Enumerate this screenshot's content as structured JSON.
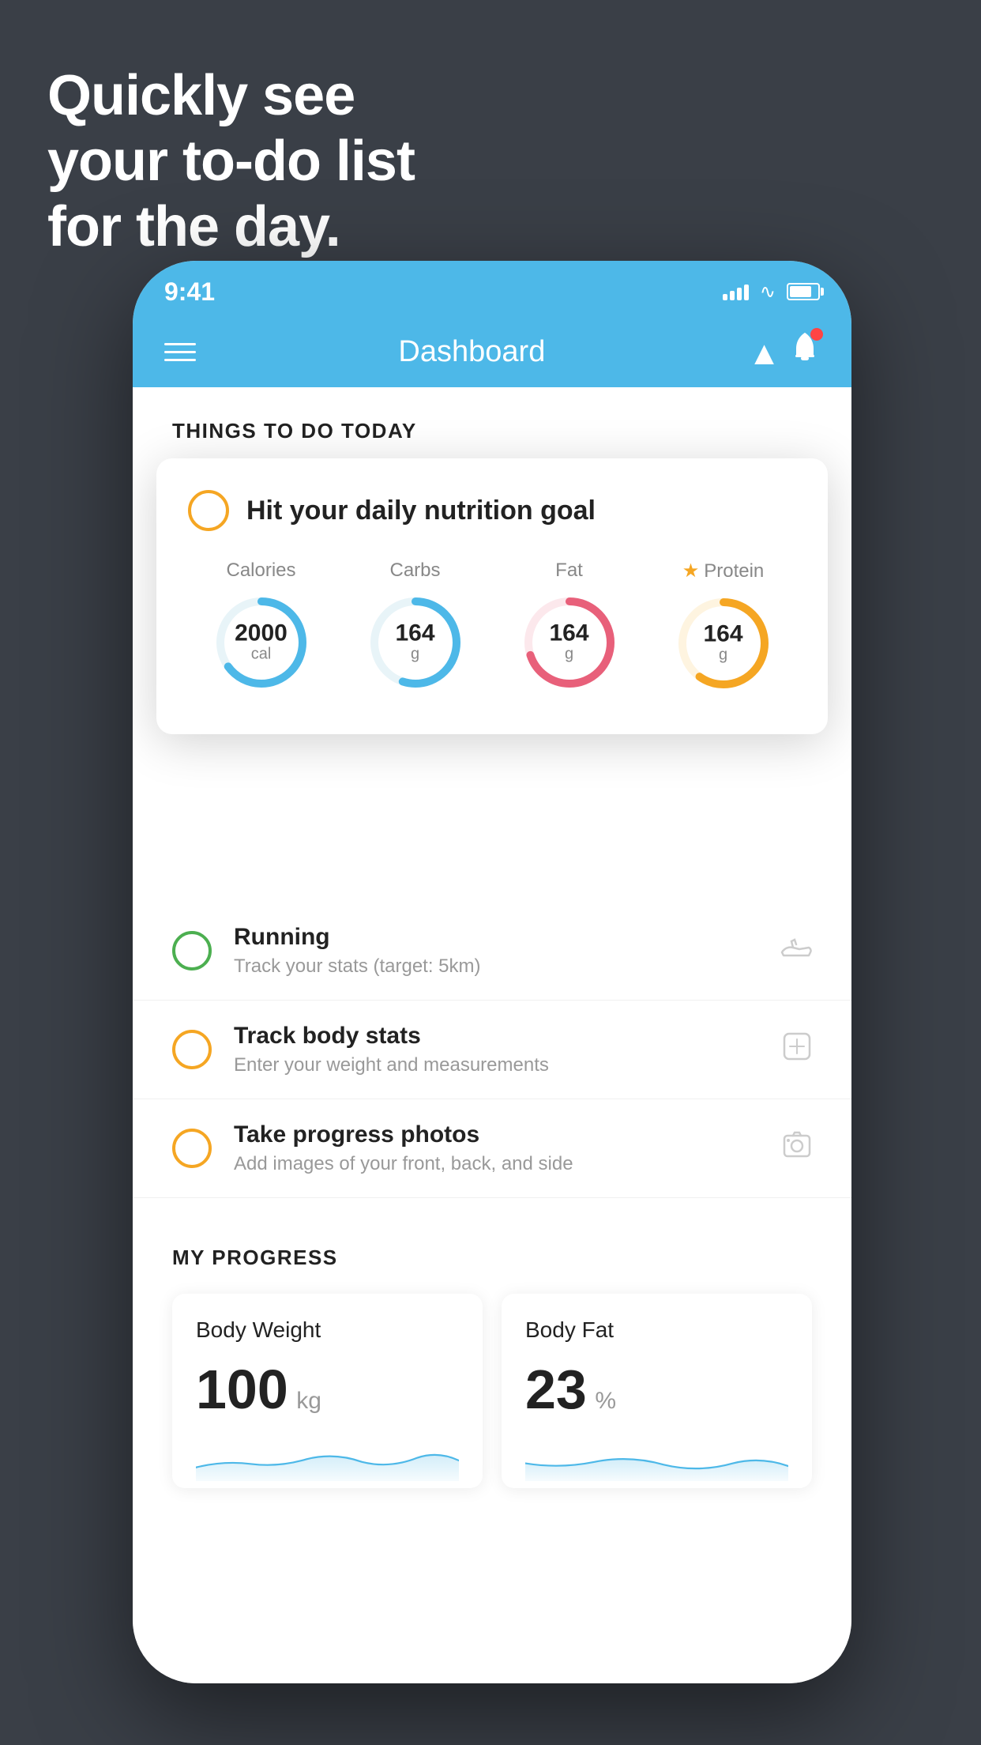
{
  "hero": {
    "line1": "Quickly see",
    "line2": "your to-do list",
    "line3": "for the day."
  },
  "status_bar": {
    "time": "9:41",
    "signal": "signal-icon",
    "wifi": "wifi-icon",
    "battery": "battery-icon"
  },
  "nav": {
    "title": "Dashboard",
    "menu_icon": "hamburger-icon",
    "bell_icon": "bell-icon"
  },
  "section_header": "THINGS TO DO TODAY",
  "featured_card": {
    "check_icon": "circle-check-icon",
    "title": "Hit your daily nutrition goal",
    "nutrition": [
      {
        "label": "Calories",
        "value": "2000",
        "unit": "cal",
        "color": "#4db8e8",
        "percent": 65,
        "starred": false
      },
      {
        "label": "Carbs",
        "value": "164",
        "unit": "g",
        "color": "#4db8e8",
        "percent": 55,
        "starred": false
      },
      {
        "label": "Fat",
        "value": "164",
        "unit": "g",
        "color": "#e8607a",
        "percent": 70,
        "starred": false
      },
      {
        "label": "Protein",
        "value": "164",
        "unit": "g",
        "color": "#f5a623",
        "percent": 60,
        "starred": true
      }
    ]
  },
  "tasks": [
    {
      "id": "running",
      "title": "Running",
      "subtitle": "Track your stats (target: 5km)",
      "circle_color": "green",
      "icon": "shoe-icon"
    },
    {
      "id": "track-body",
      "title": "Track body stats",
      "subtitle": "Enter your weight and measurements",
      "circle_color": "yellow",
      "icon": "scale-icon"
    },
    {
      "id": "progress-photos",
      "title": "Take progress photos",
      "subtitle": "Add images of your front, back, and side",
      "circle_color": "yellow",
      "icon": "photo-icon"
    }
  ],
  "progress": {
    "header": "MY PROGRESS",
    "cards": [
      {
        "id": "body-weight",
        "title": "Body Weight",
        "value": "100",
        "unit": "kg"
      },
      {
        "id": "body-fat",
        "title": "Body Fat",
        "value": "23",
        "unit": "%"
      }
    ]
  }
}
